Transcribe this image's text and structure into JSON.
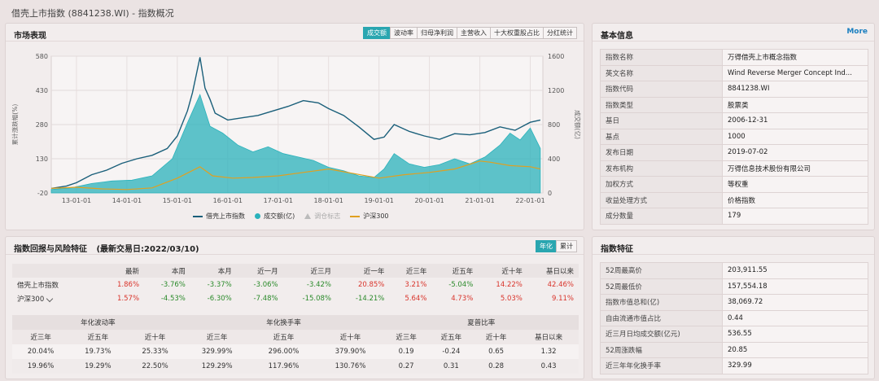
{
  "page": {
    "title": "借壳上市指数 (8841238.WI) - 指数概况"
  },
  "market": {
    "heading": "市场表现",
    "tabs": [
      "成交额",
      "波动率",
      "归母净利润",
      "主营收入",
      "十大权重股占比",
      "分红统计"
    ],
    "active_tab": 0,
    "legend": [
      "借壳上市指数",
      "成交额(亿)",
      "调仓标志",
      "沪深300"
    ]
  },
  "chart_data": {
    "type": "line",
    "x_ticks": [
      "13-01-01",
      "14-01-01",
      "15-01-01",
      "16-01-01",
      "17-01-01",
      "18-01-01",
      "19-01-01",
      "20-01-01",
      "21-01-01",
      "22-01-01"
    ],
    "ylabel": "累计涨跌幅(%)",
    "y2label": "成交额(亿)",
    "ylim": [
      -20,
      580
    ],
    "y_ticks": [
      -20,
      130,
      280,
      430,
      580
    ],
    "y2lim": [
      0,
      1600
    ],
    "y2_ticks": [
      0,
      400,
      800,
      1200,
      1600
    ],
    "series": [
      {
        "name": "借壳上市指数",
        "color": "#1a5f7a",
        "axis": "left",
        "x": [
          2012.5,
          2012.8,
          2013.0,
          2013.3,
          2013.6,
          2013.9,
          2014.2,
          2014.5,
          2014.8,
          2015.0,
          2015.2,
          2015.3,
          2015.45,
          2015.55,
          2015.65,
          2015.75,
          2016.0,
          2016.3,
          2016.6,
          2016.9,
          2017.2,
          2017.5,
          2017.8,
          2018.0,
          2018.3,
          2018.6,
          2018.9,
          2019.1,
          2019.3,
          2019.6,
          2019.9,
          2020.2,
          2020.5,
          2020.8,
          2021.1,
          2021.4,
          2021.7,
          2022.0,
          2022.2
        ],
        "values": [
          0,
          10,
          25,
          60,
          80,
          110,
          130,
          145,
          175,
          230,
          340,
          420,
          575,
          440,
          390,
          330,
          300,
          310,
          320,
          340,
          360,
          385,
          375,
          350,
          320,
          270,
          215,
          225,
          280,
          250,
          230,
          215,
          240,
          235,
          245,
          270,
          255,
          290,
          300
        ]
      },
      {
        "name": "沪深300",
        "color": "#e0a020",
        "axis": "left",
        "x": [
          2012.5,
          2013.0,
          2013.5,
          2014.0,
          2014.5,
          2015.0,
          2015.45,
          2015.7,
          2016.1,
          2016.5,
          2017.0,
          2017.5,
          2018.0,
          2018.5,
          2019.0,
          2019.5,
          2020.0,
          2020.5,
          2021.0,
          2021.2,
          2021.6,
          2022.0,
          2022.2
        ],
        "values": [
          0,
          5,
          -2,
          -5,
          2,
          45,
          95,
          55,
          45,
          48,
          55,
          70,
          85,
          65,
          45,
          60,
          70,
          85,
          120,
          115,
          100,
          95,
          85
        ]
      },
      {
        "name": "成交额(亿)",
        "color": "#2ab2bb",
        "axis": "right",
        "type": "area",
        "x": [
          2012.5,
          2012.9,
          2013.3,
          2013.7,
          2014.1,
          2014.5,
          2014.9,
          2015.2,
          2015.45,
          2015.65,
          2015.9,
          2016.2,
          2016.5,
          2016.8,
          2017.1,
          2017.4,
          2017.7,
          2018.0,
          2018.3,
          2018.6,
          2018.9,
          2019.1,
          2019.3,
          2019.6,
          2019.9,
          2020.2,
          2020.5,
          2020.8,
          2021.1,
          2021.4,
          2021.6,
          2021.8,
          2022.0,
          2022.2
        ],
        "values": [
          40,
          60,
          110,
          140,
          150,
          200,
          400,
          820,
          1150,
          780,
          700,
          560,
          480,
          540,
          460,
          420,
          380,
          300,
          260,
          200,
          180,
          280,
          460,
          340,
          300,
          330,
          400,
          340,
          420,
          560,
          700,
          620,
          760,
          520
        ]
      }
    ]
  },
  "basic": {
    "heading": "基本信息",
    "more": "More",
    "rows": [
      {
        "k": "指数名称",
        "v": "万得借壳上市概念指数"
      },
      {
        "k": "英文名称",
        "v": "Wind Reverse Merger Concept Ind..."
      },
      {
        "k": "指数代码",
        "v": "8841238.WI"
      },
      {
        "k": "指数类型",
        "v": "股票类"
      },
      {
        "k": "基日",
        "v": "2006-12-31"
      },
      {
        "k": "基点",
        "v": "1000"
      },
      {
        "k": "发布日期",
        "v": "2019-07-02"
      },
      {
        "k": "发布机构",
        "v": "万得信息技术股份有限公司"
      },
      {
        "k": "加权方式",
        "v": "等权重"
      },
      {
        "k": "收益处理方式",
        "v": "价格指数"
      },
      {
        "k": "成分数量",
        "v": "179"
      }
    ]
  },
  "returns": {
    "heading": "指数回报与风险特征",
    "date_note": "(最新交易日:2022/03/10)",
    "toggle": [
      "年化",
      "累计"
    ],
    "columns": [
      "",
      "最新",
      "本周",
      "本月",
      "近一月",
      "近三月",
      "近一年",
      "近三年",
      "近五年",
      "近十年",
      "基日以来"
    ],
    "rows": [
      {
        "name": "借壳上市指数",
        "values": [
          "1.86%",
          "-3.76%",
          "-3.37%",
          "-3.06%",
          "-3.42%",
          "20.85%",
          "3.21%",
          "-5.04%",
          "14.22%",
          "42.46%"
        ]
      },
      {
        "name": "沪深300",
        "values": [
          "1.57%",
          "-4.53%",
          "-6.30%",
          "-7.48%",
          "-15.08%",
          "-14.21%",
          "5.64%",
          "4.73%",
          "5.03%",
          "9.11%"
        ]
      }
    ],
    "stat_groups": [
      "年化波动率",
      "年化换手率",
      "夏普比率"
    ],
    "stat_columns": [
      "近三年",
      "近五年",
      "近十年",
      "近三年",
      "近五年",
      "近十年",
      "近三年",
      "近五年",
      "近十年",
      "基日以来"
    ],
    "stat_rows": [
      [
        "20.04%",
        "19.73%",
        "25.33%",
        "329.99%",
        "296.00%",
        "379.90%",
        "0.19",
        "-0.24",
        "0.65",
        "1.32"
      ],
      [
        "19.96%",
        "19.29%",
        "22.50%",
        "129.29%",
        "117.96%",
        "130.76%",
        "0.27",
        "0.31",
        "0.28",
        "0.43"
      ]
    ]
  },
  "features": {
    "heading": "指数特征",
    "rows": [
      {
        "k": "52周最高价",
        "v": "203,911.55"
      },
      {
        "k": "52周最低价",
        "v": "157,554.18"
      },
      {
        "k": "指数市值总和(亿)",
        "v": "38,069.72"
      },
      {
        "k": "自由流通市值占比",
        "v": "0.44"
      },
      {
        "k": "近三月日均成交额(亿元)",
        "v": "536.55"
      },
      {
        "k": "52周涨跌幅",
        "v": "20.85"
      },
      {
        "k": "近三年年化换手率",
        "v": "329.99"
      }
    ]
  },
  "colors": {
    "accent": "#2aa6b0",
    "up": "#d9342b",
    "down": "#2a8a2a"
  }
}
